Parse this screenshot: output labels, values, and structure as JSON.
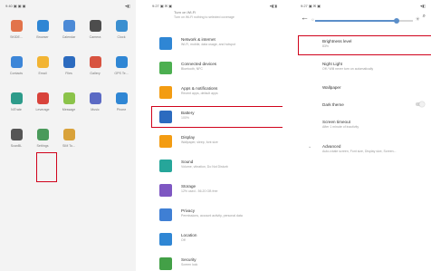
{
  "home": {
    "status_left": "9:40 ▣ ▣ ▣",
    "status_right": "▾◧",
    "apps": [
      {
        "label": "SKIDE...",
        "color": "#e2734a"
      },
      {
        "label": "Browser",
        "color": "#2f86d4"
      },
      {
        "label": "Calendar",
        "color": "#4c8ad6"
      },
      {
        "label": "Camera",
        "color": "#4d4d4d"
      },
      {
        "label": "Clock",
        "color": "#3b8fd0"
      },
      {
        "label": "Contacts",
        "color": "#3d86d8"
      },
      {
        "label": "Email",
        "color": "#f2b433"
      },
      {
        "label": "Files",
        "color": "#2c6bbf"
      },
      {
        "label": "Gallery",
        "color": "#d85340"
      },
      {
        "label": "GPS Te...",
        "color": "#2f86d4"
      },
      {
        "label": "NiTrate",
        "color": "#2d9b8a"
      },
      {
        "label": "Leverage",
        "color": "#d8433b"
      },
      {
        "label": "Message",
        "color": "#8bc34a"
      },
      {
        "label": "Music",
        "color": "#5b6ac4"
      },
      {
        "label": "Phone",
        "color": "#2f86d4"
      },
      {
        "label": "ScanBL",
        "color": "#555555"
      },
      {
        "label": "Settings",
        "color": "#4a9a5b"
      },
      {
        "label": "SIM To...",
        "color": "#d9a23a"
      }
    ]
  },
  "settings": {
    "status_left": "9:27 ▣ ✉ ▣",
    "status_right": "▾◧▮",
    "top_cut": "Turn on Wi-Fi",
    "top_cut_sub": "Turn on Wi-Fi nothing to selected coverage",
    "items": [
      {
        "title": "Network & internet",
        "sub": "Wi-Fi, mobile, data usage, and hotspot",
        "color": "#2f86d4"
      },
      {
        "title": "Connected devices",
        "sub": "Bluetooth, NFC",
        "color": "#4caf50"
      },
      {
        "title": "Apps & notifications",
        "sub": "Recent apps, default apps",
        "color": "#f39c12"
      },
      {
        "title": "Battery",
        "sub": "100%",
        "color": "#2c6bbf"
      },
      {
        "title": "Display",
        "sub": "Wallpaper, sleep, font size",
        "color": "#f39c12"
      },
      {
        "title": "Sound",
        "sub": "Volume, vibration, Do Not Disturb",
        "color": "#26a69a"
      },
      {
        "title": "Storage",
        "sub": "12% used - 56.20 GB free",
        "color": "#7e57c2"
      },
      {
        "title": "Privacy",
        "sub": "Permissions, account activity, personal data",
        "color": "#3f7fd4"
      },
      {
        "title": "Location",
        "sub": "Off",
        "color": "#2f86d4"
      },
      {
        "title": "Security",
        "sub": "Screen lock",
        "color": "#43a047"
      }
    ]
  },
  "display": {
    "status_left": "9:27 ▣ ✉ ▣",
    "status_right": "▾◧",
    "back": "←",
    "search": "⌕",
    "brightness_level": 0.83,
    "items": [
      {
        "title": "Brightness level",
        "sub": "83%"
      },
      {
        "title": "Night Light",
        "sub": "Off / Will never turn on automatically"
      },
      {
        "title": "Wallpaper",
        "sub": ""
      },
      {
        "title": "Dark theme",
        "sub": ""
      },
      {
        "title": "Screen timeout",
        "sub": "After 1 minute of inactivity"
      },
      {
        "title": "Advanced",
        "sub": "Auto-rotate screen, Font size, Display size, Screen..."
      }
    ],
    "chevron": "⌄"
  },
  "colors": {
    "highlight": "#d0021b",
    "accent": "#5b8ec9"
  }
}
